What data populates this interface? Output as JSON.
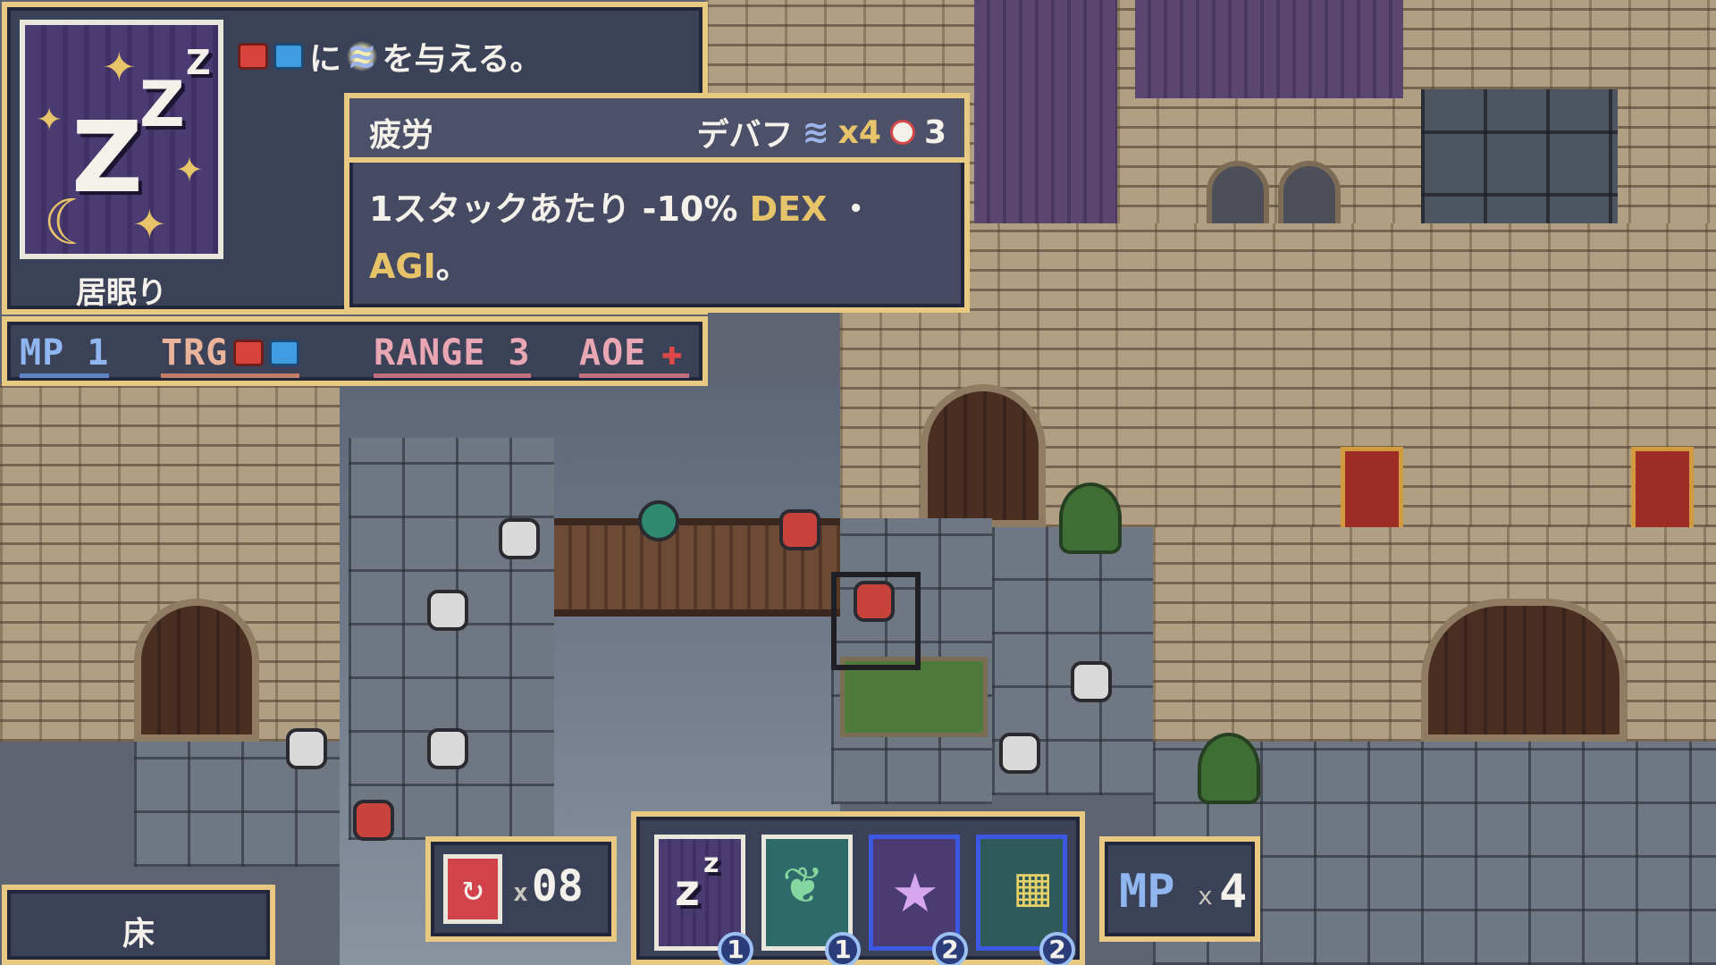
{
  "card": {
    "name": "居眠り",
    "art_icon": "sleep-zzz-icon",
    "effect_connector": "に",
    "effect_text": "を与える。",
    "effect_targets": [
      "enemy-icon",
      "ally-icon"
    ],
    "effect_status_icon": "fatigue-icon"
  },
  "stats": {
    "mp": "MP 1",
    "trg": "TRG",
    "range": "RANGE 3",
    "aoe": "AOE",
    "aoe_icon": "cross-aoe-icon"
  },
  "tooltip": {
    "title": "疲労",
    "type": "デバフ",
    "stack": "x4",
    "duration": "3",
    "body_prefix": "1スタックあたり -10% ",
    "body_stat1": "DEX",
    "body_sep": " ・",
    "body_stat2": "AGI",
    "body_suffix": "。"
  },
  "floor": {
    "label": "床"
  },
  "deck": {
    "icon": "discard-pile-icon",
    "x": "x",
    "count": "08"
  },
  "hand": {
    "cards": [
      {
        "name": "sleep-card",
        "cost": "1",
        "rarity": "common",
        "color": "#4a3b73"
      },
      {
        "name": "vine-card",
        "cost": "1",
        "rarity": "common",
        "color": "#2f6a6a"
      },
      {
        "name": "star-card",
        "cost": "2",
        "rarity": "rare",
        "color": "#4a3b73"
      },
      {
        "name": "window-card",
        "cost": "2",
        "rarity": "rare",
        "color": "#2f5a5a"
      }
    ]
  },
  "mp": {
    "label": "MP",
    "x": "x",
    "value": "4"
  },
  "colors": {
    "panel_bg": "#3b4258",
    "panel_border": "#e8c981",
    "mp_blue": "#8fb6ef",
    "highlight_gold": "#e7c46a"
  }
}
